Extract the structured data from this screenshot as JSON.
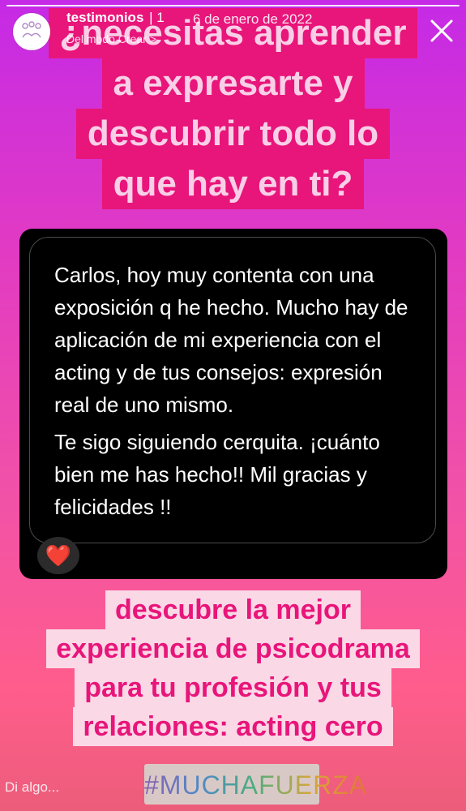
{
  "header": {
    "account_name": "testimonios",
    "separator": "| 1",
    "date": "6 de enero de 2022",
    "subtitle": "Del modo Crear >"
  },
  "headline": {
    "lines": [
      "¿necesitas aprender",
      "a expresarte y",
      "descubrir todo lo",
      "que hay en ti?"
    ]
  },
  "message": {
    "paragraphs": [
      "Carlos, hoy muy contenta con una exposición q he hecho. Mucho hay de aplicación de mi experiencia con el acting y de tus consejos: expresión real de uno mismo.",
      "Te sigo siguiendo cerquita. ¡cuánto bien  me has hecho!! Mil gracias y felicidades !!"
    ],
    "reaction": "❤️"
  },
  "cta": {
    "lines": [
      "descubre la mejor",
      "experiencia de psicodrama",
      "para tu profesión y tus",
      "relaciones: acting cero"
    ]
  },
  "footer": {
    "reply_placeholder": "Di algo...",
    "hashtag": "#MUCHAFUERZA"
  },
  "colors": {
    "headline_bg": "#e8157a",
    "headline_text": "#f9cfe7",
    "cta_bg": "#fbd8e6",
    "cta_text": "#e8157a",
    "card_bg": "#000000"
  },
  "icons": {
    "close": "close-icon",
    "avatar": "avatar-icon",
    "heart": "heart-icon"
  }
}
